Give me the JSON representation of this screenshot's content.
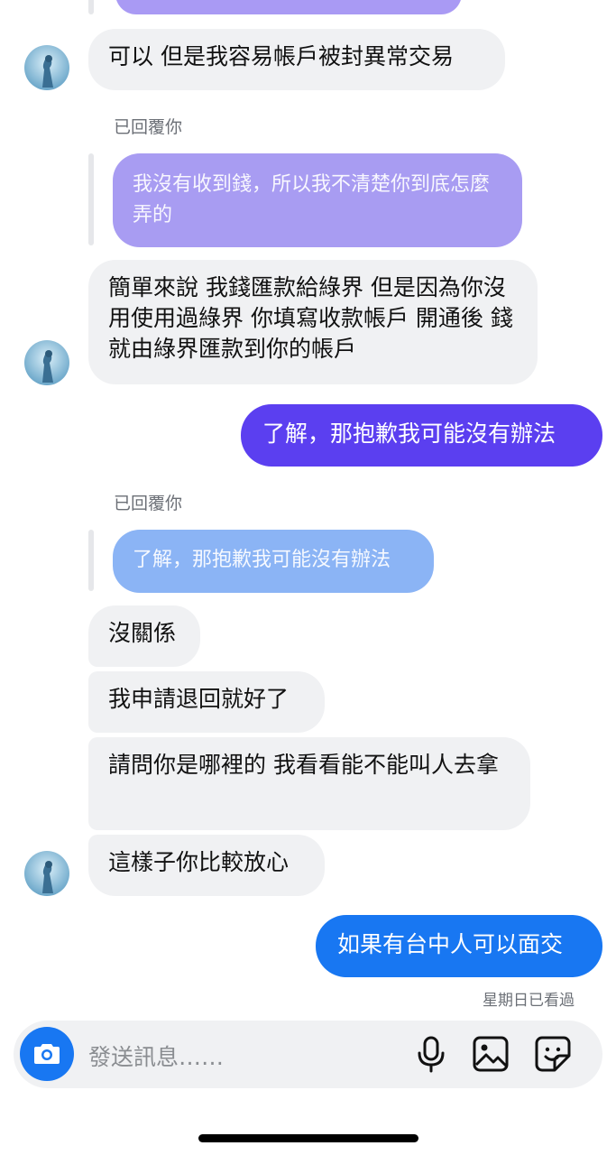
{
  "messages": {
    "m1": "可以 但是我容易帳戶被封異常交易",
    "reply_label_1": "已回覆你",
    "quoted_1": "我沒有收到錢，所以我不清楚你到底怎麼弄的",
    "m2": "簡單來說 我錢匯款給綠界 但是因為你沒用使用過綠界 你填寫收款帳戶 開通後 錢就由綠界匯款到你的帳戶",
    "out_1": "了解，那抱歉我可能沒有辦法",
    "reply_label_2": "已回覆你",
    "quoted_2": "了解，那抱歉我可能沒有辦法",
    "m3": "沒關係",
    "m4": "我申請退回就好了",
    "m5": "請問你是哪裡的 我看看能不能叫人去拿",
    "m6": "這樣子你比較放心",
    "out_2": "如果有台中人可以面交",
    "seen": "星期日已看過"
  },
  "composer": {
    "placeholder": "發送訊息……",
    "camera_icon": "camera-icon",
    "mic_icon": "microphone-icon",
    "gallery_icon": "image-icon",
    "sticker_icon": "sticker-icon"
  },
  "colors": {
    "incoming_bg": "#f0f1f3",
    "out_purple": "#5b3ff0",
    "out_blue": "#1877f2",
    "quoted_purple": "#a89cf2",
    "quoted_blue": "#8bb4f5",
    "camera_bg": "#1877f2"
  }
}
